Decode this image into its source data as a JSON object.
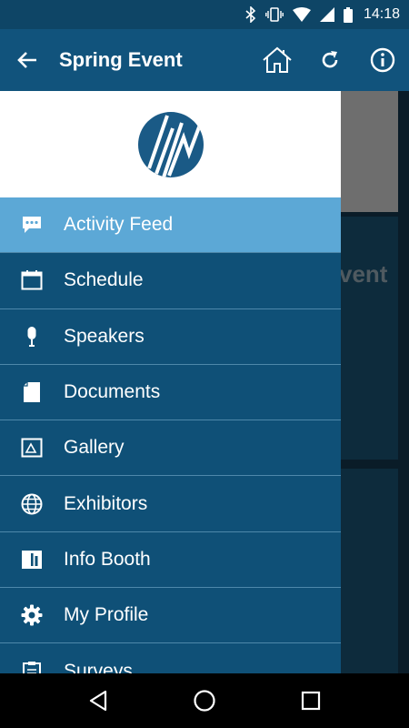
{
  "status_bar": {
    "time": "14:18",
    "icons": [
      "bluetooth-icon",
      "vibrate-icon",
      "wifi-icon",
      "signal-icon",
      "battery-icon"
    ]
  },
  "app_bar": {
    "title": "Spring Event",
    "icons": [
      "back-arrow-icon",
      "home-icon",
      "refresh-icon",
      "info-icon"
    ]
  },
  "background": {
    "card_text": "vent"
  },
  "drawer": {
    "logo": "event-logo",
    "items": [
      {
        "label": "Activity Feed",
        "icon": "chat-bubble-icon",
        "active": true
      },
      {
        "label": "Schedule",
        "icon": "calendar-icon"
      },
      {
        "label": "Speakers",
        "icon": "microphone-icon"
      },
      {
        "label": "Documents",
        "icon": "document-icon"
      },
      {
        "label": "Gallery",
        "icon": "gallery-icon"
      },
      {
        "label": "Exhibitors",
        "icon": "globe-icon"
      },
      {
        "label": "Info Booth",
        "icon": "info-booth-icon"
      },
      {
        "label": "My Profile",
        "icon": "gear-icon"
      },
      {
        "label": "Surveys",
        "icon": "clipboard-icon"
      }
    ]
  },
  "colors": {
    "app_bar": "#11537c",
    "status_bar": "#0e4566",
    "drawer": "#0f5077",
    "active_item": "#5ca8d6"
  }
}
